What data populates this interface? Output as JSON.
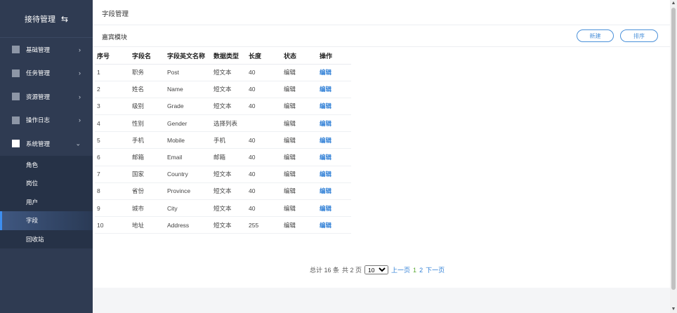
{
  "sidebar": {
    "title": "接待管理",
    "swap_icon": "⇆",
    "items": [
      {
        "label": "基础管理",
        "chev": "›"
      },
      {
        "label": "任务管理",
        "chev": "›"
      },
      {
        "label": "资源管理",
        "chev": "›"
      },
      {
        "label": "操作日志",
        "chev": "›"
      },
      {
        "label": "系统管理",
        "chev": "⌄"
      }
    ],
    "subitems": [
      {
        "label": "角色"
      },
      {
        "label": "岗位"
      },
      {
        "label": "用户"
      },
      {
        "label": "字段"
      },
      {
        "label": "回收站"
      }
    ]
  },
  "main": {
    "page_title": "字段管理",
    "module_title": "嘉宾模块",
    "new_label": "新建",
    "sort_label": "排序"
  },
  "table": {
    "headers": [
      "序号",
      "字段名",
      "字段英文名称",
      "数据类型",
      "长度",
      "状态",
      "操作"
    ],
    "rows": [
      {
        "no": "1",
        "name": "职务",
        "en": "Post",
        "type": "短文本",
        "len": "40",
        "status": "编辑",
        "op": "编辑"
      },
      {
        "no": "2",
        "name": "姓名",
        "en": "Name",
        "type": "短文本",
        "len": "40",
        "status": "编辑",
        "op": "编辑"
      },
      {
        "no": "3",
        "name": "级别",
        "en": "Grade",
        "type": "短文本",
        "len": "40",
        "status": "编辑",
        "op": "编辑"
      },
      {
        "no": "4",
        "name": "性别",
        "en": "Gender",
        "type": "选择列表",
        "len": "",
        "status": "编辑",
        "op": "编辑"
      },
      {
        "no": "5",
        "name": "手机",
        "en": "Mobile",
        "type": "手机",
        "len": "40",
        "status": "编辑",
        "op": "编辑"
      },
      {
        "no": "6",
        "name": "邮箱",
        "en": "Email",
        "type": "邮箱",
        "len": "40",
        "status": "编辑",
        "op": "编辑"
      },
      {
        "no": "7",
        "name": "国家",
        "en": "Country",
        "type": "短文本",
        "len": "40",
        "status": "编辑",
        "op": "编辑"
      },
      {
        "no": "8",
        "name": "省份",
        "en": "Province",
        "type": "短文本",
        "len": "40",
        "status": "编辑",
        "op": "编辑"
      },
      {
        "no": "9",
        "name": "城市",
        "en": "City",
        "type": "短文本",
        "len": "40",
        "status": "编辑",
        "op": "编辑"
      },
      {
        "no": "10",
        "name": "地址",
        "en": "Address",
        "type": "短文本",
        "len": "255",
        "status": "编辑",
        "op": "编辑"
      }
    ]
  },
  "pager": {
    "total": "总计 16 条",
    "pages": "共 2 页",
    "page_size": "10",
    "prev": "上一页",
    "page1": "1",
    "page2": "2",
    "next": "下一页"
  },
  "scrollbar": {
    "up": "▲",
    "down": "▼"
  }
}
